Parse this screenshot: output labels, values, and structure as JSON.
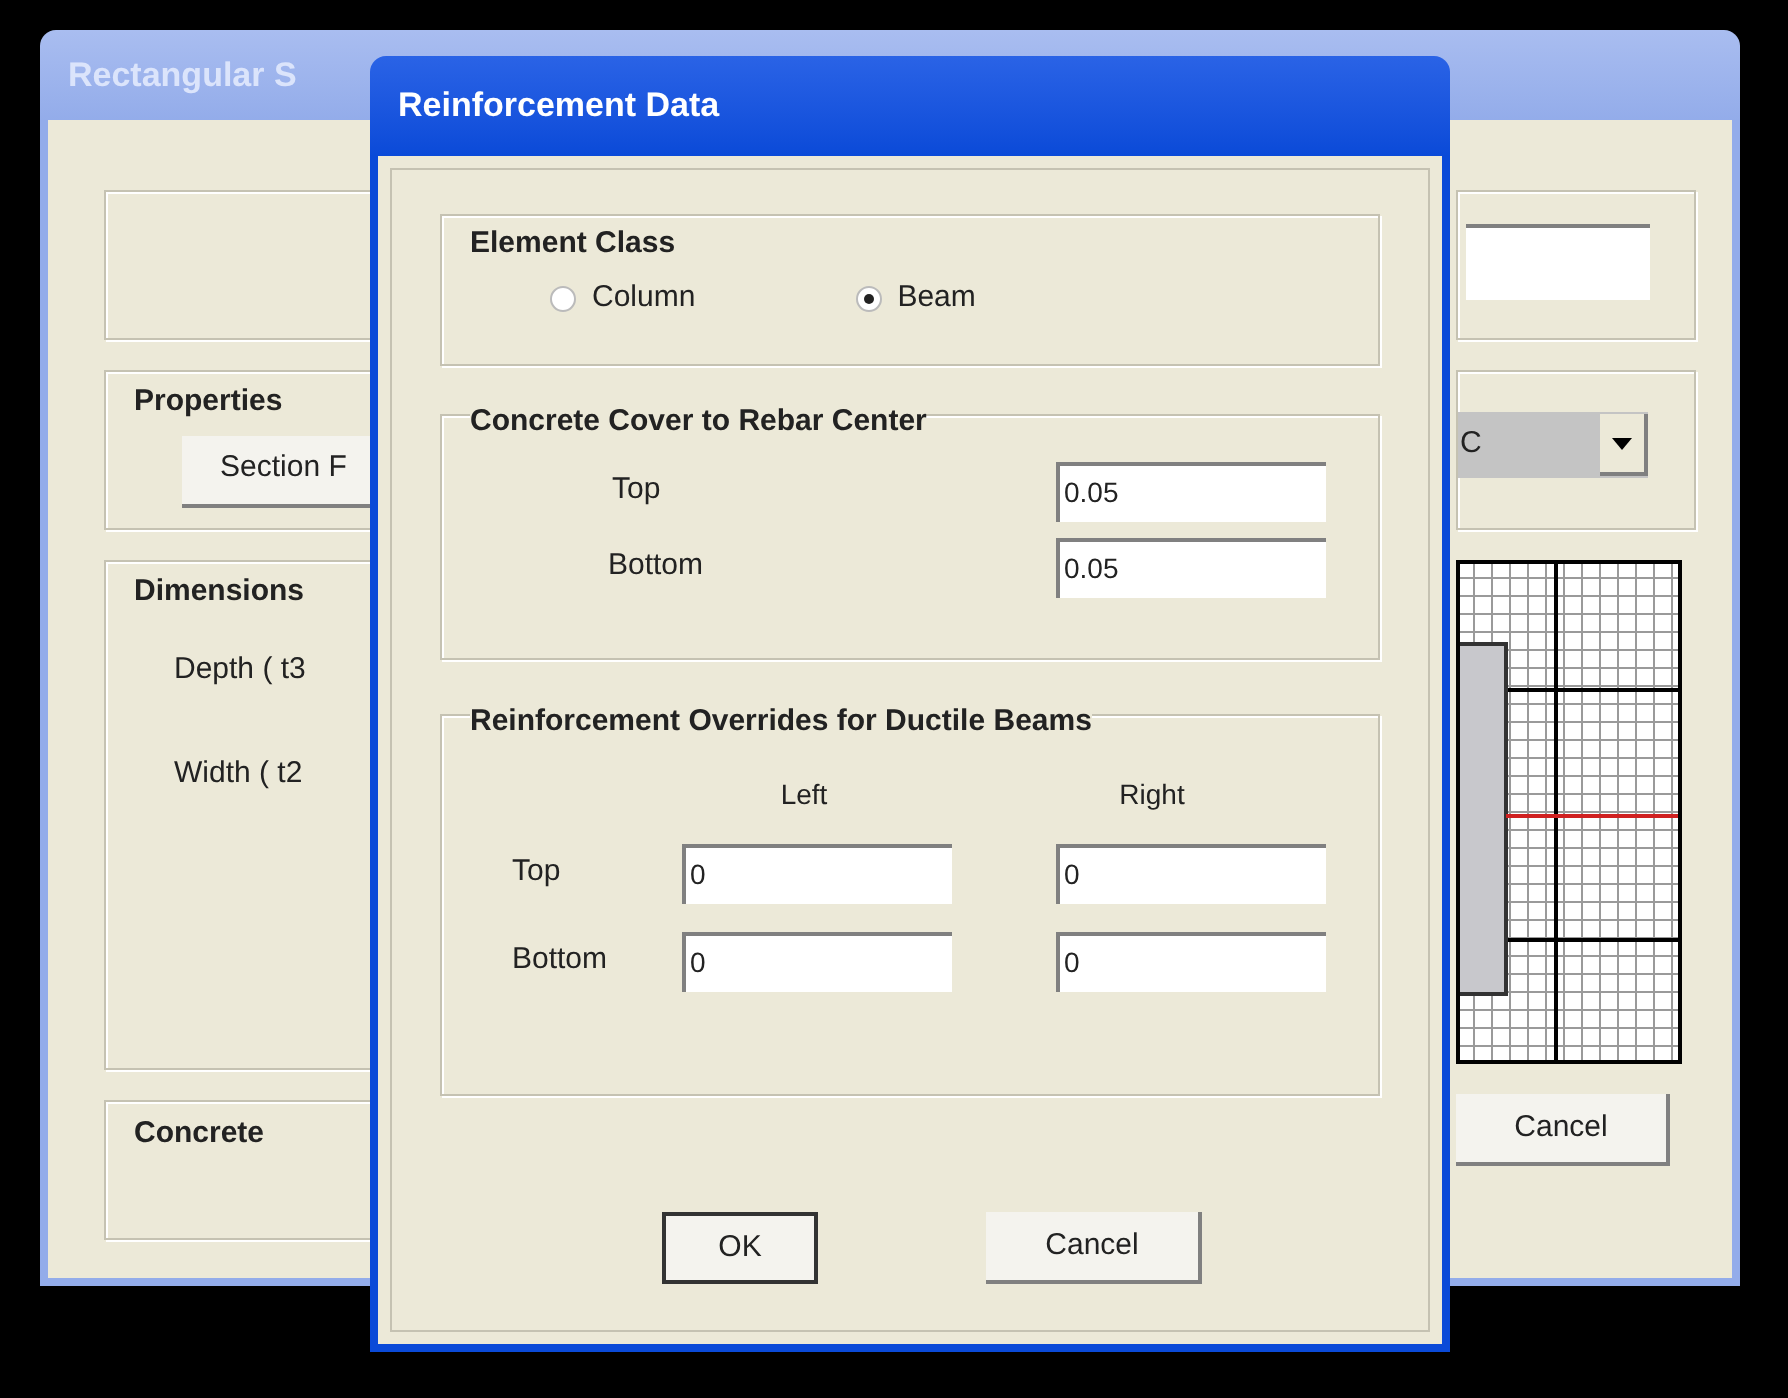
{
  "back_window": {
    "title": "Rectangular S",
    "active": false,
    "properties": {
      "label": "Properties",
      "button": "Section F"
    },
    "material_dropdown": {
      "value": "C"
    },
    "dimensions": {
      "label": "Dimensions",
      "fields": [
        {
          "label": "Depth ( t3"
        },
        {
          "label": "Width ( t2"
        }
      ]
    },
    "concrete": {
      "label": "Concrete"
    },
    "cancel_button": "Cancel"
  },
  "dialog": {
    "title": "Reinforcement Data",
    "active": true,
    "element_class": {
      "label": "Element Class",
      "options": [
        {
          "label": "Column",
          "selected": false
        },
        {
          "label": "Beam",
          "selected": true
        }
      ]
    },
    "cover": {
      "label": "Concrete Cover to Rebar Center",
      "fields": [
        {
          "label": "Top",
          "value": "0.05"
        },
        {
          "label": "Bottom",
          "value": "0.05"
        }
      ]
    },
    "overrides": {
      "label": "Reinforcement Overrides for Ductile Beams",
      "columns": [
        "Left",
        "Right"
      ],
      "rows": [
        {
          "label": "Top",
          "values": [
            "0",
            "0"
          ]
        },
        {
          "label": "Bottom",
          "values": [
            "0",
            "0"
          ]
        }
      ]
    },
    "buttons": [
      {
        "label": "OK",
        "default": true
      },
      {
        "label": "Cancel",
        "default": false
      }
    ]
  }
}
